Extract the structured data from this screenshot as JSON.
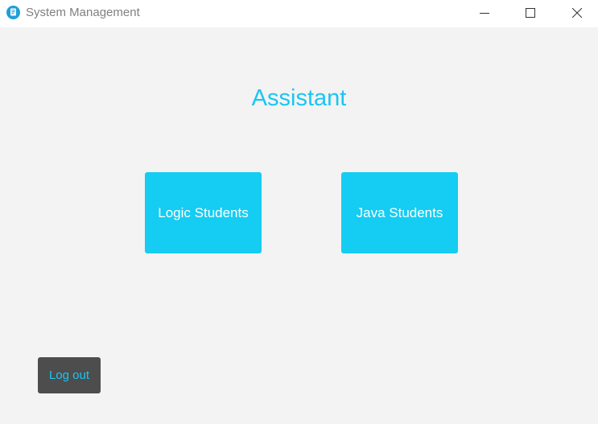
{
  "window": {
    "title": "System Management",
    "app_icon": "app-logo-icon",
    "controls": {
      "minimize_icon": "minimize-icon",
      "maximize_icon": "maximize-icon",
      "close_icon": "close-icon"
    }
  },
  "main": {
    "heading": "Assistant",
    "buttons": [
      {
        "label": "Logic Students"
      },
      {
        "label": "Java Students"
      }
    ],
    "logout_label": "Log out"
  },
  "colors": {
    "accent": "#19c6f2",
    "tile_background": "#15ccf2",
    "tile_text": "#ffffff",
    "logout_background": "#4d4d4d",
    "page_background": "#f3f3f3",
    "titlebar_background": "#ffffff",
    "title_text": "#808080"
  }
}
